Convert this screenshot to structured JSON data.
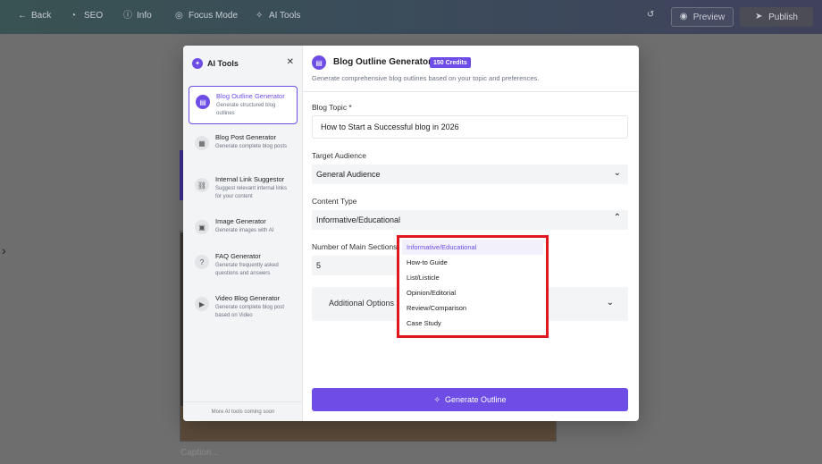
{
  "topbar": {
    "back": "Back",
    "seo": "SEO",
    "info": "Info",
    "focus": "Focus Mode",
    "ai_tools": "AI Tools",
    "preview": "Preview",
    "publish": "Publish"
  },
  "editor": {
    "caption_placeholder": "Caption..."
  },
  "sidebar": {
    "title": "AI Tools",
    "footer": "More AI tools coming soon",
    "tools": [
      {
        "name": "Blog Outline Generator",
        "desc": "Generate structured blog outlines",
        "icon": "outline-icon"
      },
      {
        "name": "Blog Post Generator",
        "desc": "Generate complete blog posts",
        "icon": "post-icon"
      },
      {
        "name": "Internal Link Suggestor",
        "desc": "Suggest relevant internal links for your content",
        "icon": "link-icon"
      },
      {
        "name": "Image Generator",
        "desc": "Generate images with AI",
        "icon": "image-icon"
      },
      {
        "name": "FAQ Generator",
        "desc": "Generate frequently asked questions and answers",
        "icon": "faq-icon"
      },
      {
        "name": "Video Blog Generator",
        "desc": "Generate complete blog post based on Video",
        "icon": "video-icon"
      }
    ]
  },
  "main": {
    "title": "Blog Outline Generator",
    "credits": "150 Credits",
    "subtitle": "Generate comprehensive blog outlines based on your topic and preferences.",
    "topic_label": "Blog Topic *",
    "topic_value": "How to Start a Successful blog in 2026",
    "audience_label": "Target Audience",
    "audience_value": "General Audience",
    "content_type_label": "Content Type",
    "content_type_value": "Informative/Educational",
    "sections_label": "Number of Main Sections",
    "sections_value": "5",
    "additional_options": "Additional Options",
    "generate_button": "Generate Outline"
  },
  "dropdown": {
    "options": [
      "Informative/Educational",
      "How-to Guide",
      "List/Listicle",
      "Opinion/Editorial",
      "Review/Comparison",
      "Case Study"
    ],
    "selected_index": 0
  },
  "colors": {
    "accent": "#6d4de6",
    "highlight": "#e0171e"
  }
}
